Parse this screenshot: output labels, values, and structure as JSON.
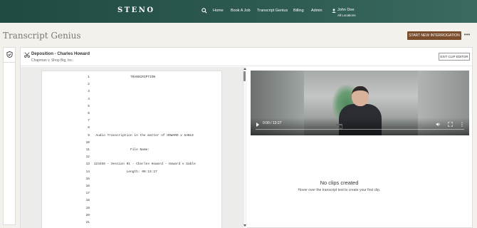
{
  "app": {
    "brand": "STENO",
    "nav": [
      "Home",
      "Book A Job",
      "Transcript Genius",
      "Billing",
      "Admin"
    ],
    "user": {
      "name": "John Doe",
      "location": "All Locations"
    }
  },
  "page": {
    "title": "Transcript Genius",
    "start_button": "START NEW INTERROGATION",
    "more_button": "•••"
  },
  "deposition": {
    "title": "Deposition - Charles Howard",
    "subtitle": "Chapman v. Shop Big, Inc.",
    "exit_button": "EXIT CLIP EDITOR"
  },
  "transcript": {
    "lines": [
      {
        "n": "1",
        "text": "                    TRANSCRIPTION"
      },
      {
        "n": "2",
        "text": ""
      },
      {
        "n": "3",
        "text": ""
      },
      {
        "n": "4",
        "text": ""
      },
      {
        "n": "5",
        "text": ""
      },
      {
        "n": "6",
        "text": ""
      },
      {
        "n": "7",
        "text": ""
      },
      {
        "n": "8",
        "text": ""
      },
      {
        "n": "9",
        "text": "  Audio Transcription in the matter of HOWARD v GABLE"
      },
      {
        "n": "10",
        "text": ""
      },
      {
        "n": "11",
        "text": "                    File Name:"
      },
      {
        "n": "12",
        "text": ""
      },
      {
        "n": "13",
        "text": " 123456 - Session 01 - Charles Howard - Howard v Gable"
      },
      {
        "n": "14",
        "text": "                  Length: 00:13:27"
      },
      {
        "n": "15",
        "text": ""
      },
      {
        "n": "16",
        "text": ""
      },
      {
        "n": "17",
        "text": ""
      },
      {
        "n": "18",
        "text": ""
      },
      {
        "n": "19",
        "text": ""
      },
      {
        "n": "20",
        "text": ""
      },
      {
        "n": "21",
        "text": ""
      }
    ]
  },
  "video": {
    "time": "0:00 / 13:27"
  },
  "clips": {
    "empty_title": "No clips created",
    "empty_hint": "Hover over the transcript text to create your first clip."
  },
  "colors": {
    "nav_bg": "#2d5a50",
    "accent_button": "#7a4e2d"
  },
  "icons": [
    "search-icon",
    "user-icon",
    "shield-icon",
    "scissors-icon",
    "play-icon",
    "volume-icon",
    "fullscreen-icon",
    "kebab-menu-icon",
    "clip-icon"
  ]
}
